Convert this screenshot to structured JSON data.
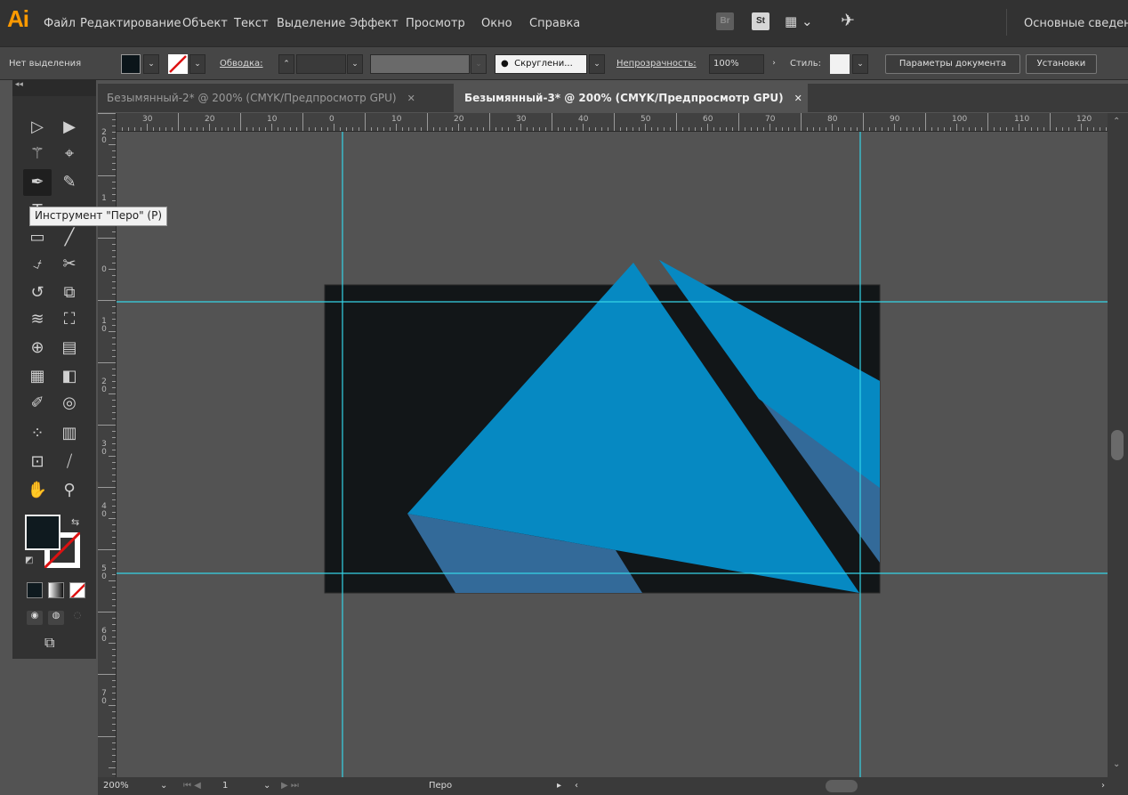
{
  "app": {
    "logo": "Ai"
  },
  "menu": {
    "items": [
      "Файл",
      "Редактирование",
      "Объект",
      "Текст",
      "Выделение",
      "Эффект",
      "Просмотр",
      "Окно",
      "Справка"
    ],
    "bridge": "Br",
    "stock": "St",
    "workspace": "Основные сведен"
  },
  "control": {
    "selection": "Нет выделения",
    "stroke_label": "Обводка:",
    "brush": "Скруглени...",
    "opacity_label": "Непрозрачность:",
    "opacity_value": "100%",
    "style_label": "Стиль:",
    "doc_settings": "Параметры документа",
    "preferences": "Установки"
  },
  "tabs": [
    {
      "label": "Безымянный-2* @ 200% (CMYK/Предпросмотр GPU)",
      "active": false
    },
    {
      "label": "Безымянный-3* @ 200% (CMYK/Предпросмотр GPU)",
      "active": true
    }
  ],
  "tooltip": "Инструмент \"Перо\" (P)",
  "ruler": {
    "h": [
      "30",
      "20",
      "10",
      "0",
      "10",
      "20",
      "30",
      "40",
      "50",
      "60",
      "70",
      "80",
      "90",
      "100",
      "110",
      "120"
    ],
    "v": [
      "2\n0",
      "1",
      "0",
      "1\n0",
      "2\n0",
      "3\n0",
      "4\n0",
      "5\n0",
      "6\n0",
      "7\n0"
    ]
  },
  "status": {
    "zoom": "200%",
    "artboard": "1",
    "tool": "Перо"
  },
  "colors": {
    "artboard": "#121618",
    "blue": "#0689c2",
    "blue_shadow": "#336a99",
    "guide": "#35d4e6",
    "fill_color": "#0f1a1f"
  }
}
